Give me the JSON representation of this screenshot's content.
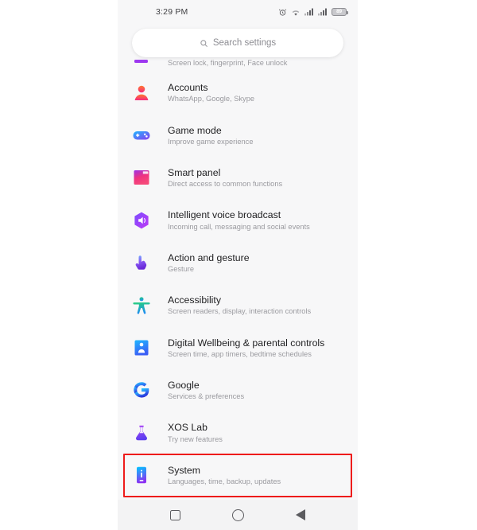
{
  "statusbar": {
    "time": "3:29 PM",
    "alarm_icon": "alarm-clock-icon",
    "wifi_icon": "wifi-icon",
    "signal1_icon": "signal-bars-icon",
    "signal2_icon": "signal-bars-icon",
    "battery_level": "89"
  },
  "search": {
    "placeholder": "Search settings",
    "icon": "search-icon"
  },
  "list": {
    "partial_row": {
      "subtitle": "Screen lock, fingerprint, Face unlock",
      "icon": "security-icon"
    },
    "items": [
      {
        "title": "Accounts",
        "subtitle": "WhatsApp, Google, Skype",
        "icon": "accounts-person-icon"
      },
      {
        "title": "Game mode",
        "subtitle": "Improve game experience",
        "icon": "gamepad-icon"
      },
      {
        "title": "Smart panel",
        "subtitle": "Direct access to common functions",
        "icon": "smart-panel-icon"
      },
      {
        "title": "Intelligent voice broadcast",
        "subtitle": "Incoming call, messaging and social events",
        "icon": "voice-broadcast-hexagon-icon"
      },
      {
        "title": "Action and gesture",
        "subtitle": "Gesture",
        "icon": "pointing-hand-icon"
      },
      {
        "title": "Accessibility",
        "subtitle": "Screen readers, display, interaction controls",
        "icon": "accessibility-person-icon"
      },
      {
        "title": "Digital Wellbeing & parental controls",
        "subtitle": "Screen time, app timers, bedtime schedules",
        "icon": "digital-wellbeing-icon"
      },
      {
        "title": "Google",
        "subtitle": "Services & preferences",
        "icon": "google-g-icon"
      },
      {
        "title": "XOS Lab",
        "subtitle": "Try new features",
        "icon": "flask-icon"
      },
      {
        "title": "System",
        "subtitle": "Languages, time, backup, updates",
        "icon": "system-phone-icon"
      }
    ],
    "highlighted_index": 9,
    "highlight_color": "#ee1b1b"
  },
  "navbar": {
    "recents_icon": "square-recents-icon",
    "home_icon": "circle-home-icon",
    "back_icon": "triangle-back-icon"
  }
}
